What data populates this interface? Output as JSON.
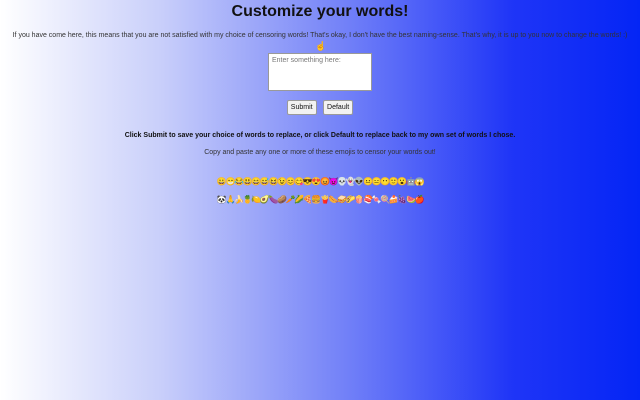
{
  "header": {
    "title": "Customize your words!"
  },
  "intro": {
    "text": "If you have come here, this means that you are not satisfied with my choice of censoring words! That's okay, I don't have the best naming-sense. That's why, it is up to you now to change the words! :)"
  },
  "cursor_icon": "pointing-hand-icon",
  "form": {
    "input_placeholder": "Enter something here:",
    "submit_label": "Submit",
    "default_label": "Default"
  },
  "instructions": {
    "text": "Click Submit to save your choice of words to replace, or click Default to replace back to my own set of words I chose."
  },
  "copy_text": {
    "text": "Copy and paste any one or more of these emojis to censor your words out!"
  },
  "emojis": {
    "row1": [
      "😀",
      "😁",
      "😂",
      "😃",
      "😄",
      "😅",
      "😆",
      "😉",
      "😊",
      "😋",
      "😎",
      "😍",
      "😡",
      "👿",
      "💀",
      "👻",
      "👽",
      "😐",
      "😑",
      "😶",
      "🙂",
      "😮",
      "🤖",
      "😱"
    ],
    "row2": [
      "🐼",
      "🙏",
      "🍌",
      "🍍",
      "🍋",
      "🥑",
      "🍆",
      "🥔",
      "🥕",
      "🌽",
      "🍕",
      "🍔",
      "🍟",
      "🌭",
      "🥪",
      "🌮",
      "🍿",
      "🍣",
      "🍬",
      "🍭",
      "🍰",
      "🍇",
      "🍉",
      "🍎"
    ]
  },
  "colors": {
    "gradient_start": "#ffffff",
    "gradient_end": "#0425f5"
  }
}
